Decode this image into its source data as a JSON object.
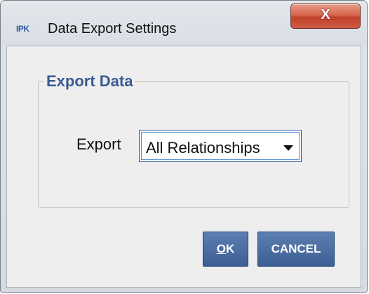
{
  "window": {
    "title": "Data Export Settings",
    "logo_text": "IPK",
    "close_label": "X"
  },
  "group": {
    "title": "Export Data"
  },
  "export": {
    "label": "Export",
    "selected": "All Relationships"
  },
  "buttons": {
    "ok_mnemonic": "O",
    "ok_rest": "K",
    "cancel": "CANCEL"
  },
  "colors": {
    "accent": "#3a5a95",
    "button": "#4a6ca0",
    "close": "#c9503a"
  }
}
